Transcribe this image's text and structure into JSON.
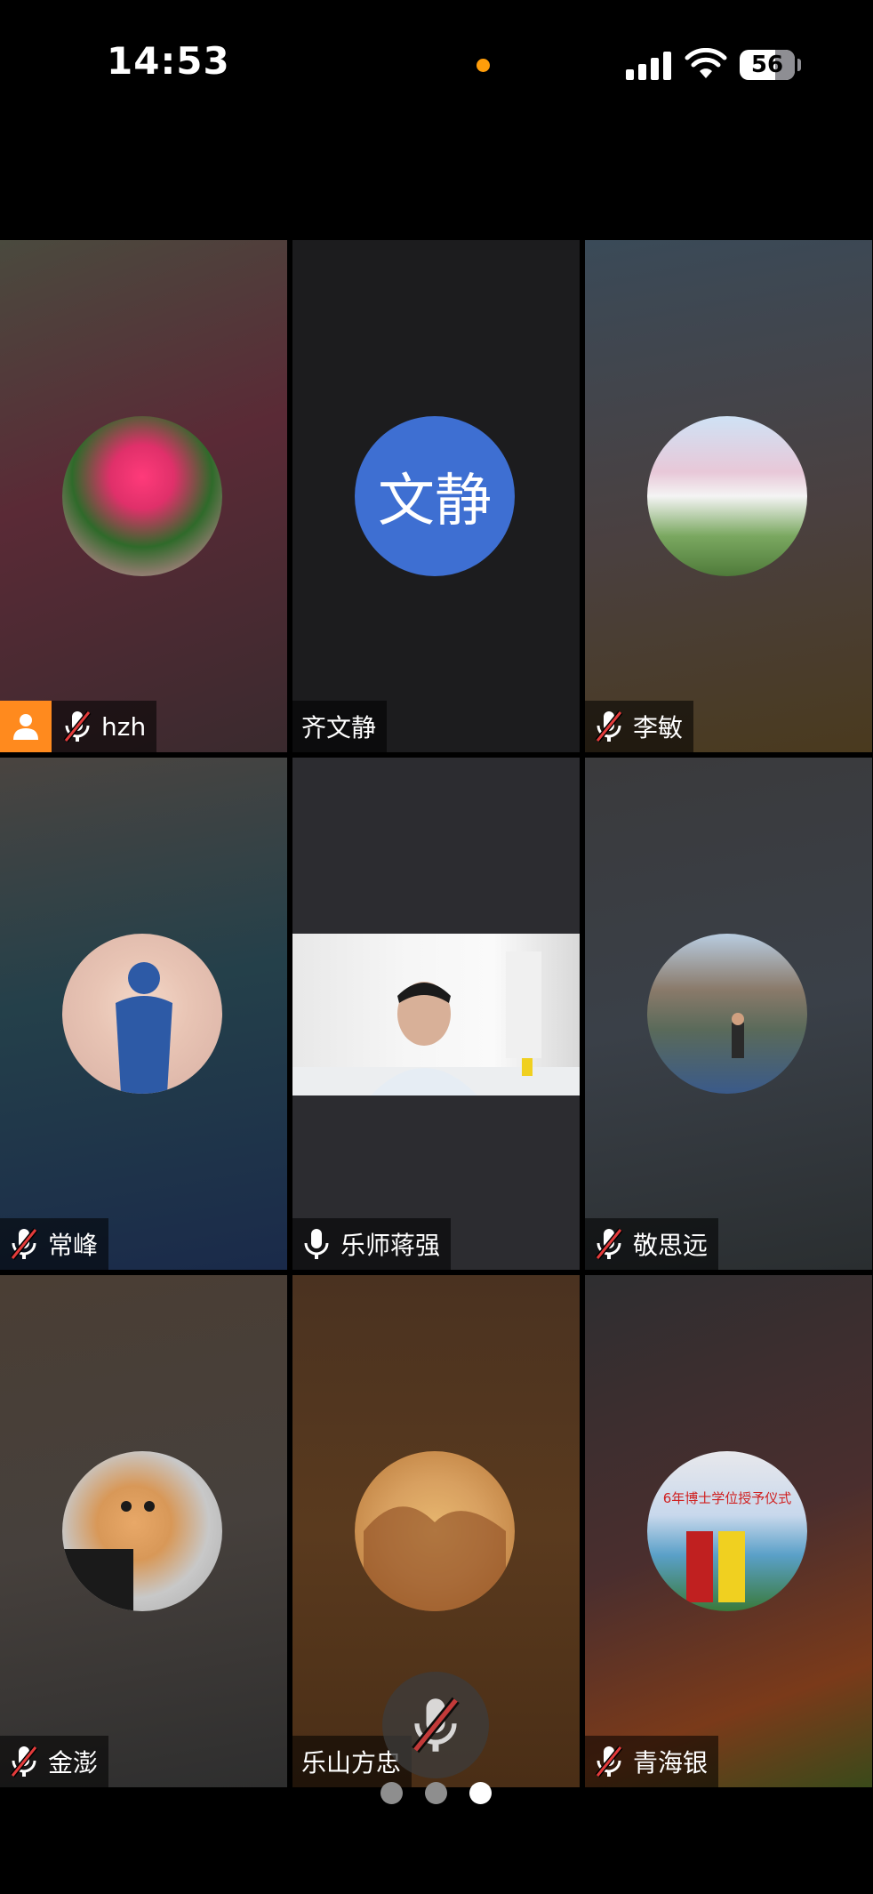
{
  "status_bar": {
    "time": "14:53",
    "battery": "56",
    "indicator_color": "#ff9d0a"
  },
  "participants": [
    {
      "name": "hzh",
      "muted": true,
      "host": true,
      "avatar": "flower-pot-photo"
    },
    {
      "name": "齐文静",
      "muted": false,
      "avatar_text": "文静",
      "avatar_color": "#3e6fd2"
    },
    {
      "name": "李敏",
      "muted": true,
      "avatar": "farmhouse-painting"
    },
    {
      "name": "常峰",
      "muted": true,
      "avatar": "shadow-photo"
    },
    {
      "name": "乐师蒋强",
      "muted": false,
      "mic_on": true,
      "video": "man-at-desk"
    },
    {
      "name": "敬思远",
      "muted": true,
      "avatar": "mountain-bridge-photo"
    },
    {
      "name": "金澎",
      "muted": true,
      "avatar": "kitten-photo"
    },
    {
      "name": "乐山方忠",
      "muted": false,
      "avatar": "landscape-painting"
    },
    {
      "name": "青海银",
      "muted": true,
      "avatar": "graduation-photo",
      "avatar_caption": "6年博士学位授予仪式"
    }
  ],
  "pager": {
    "pages": 3,
    "current": 3
  }
}
